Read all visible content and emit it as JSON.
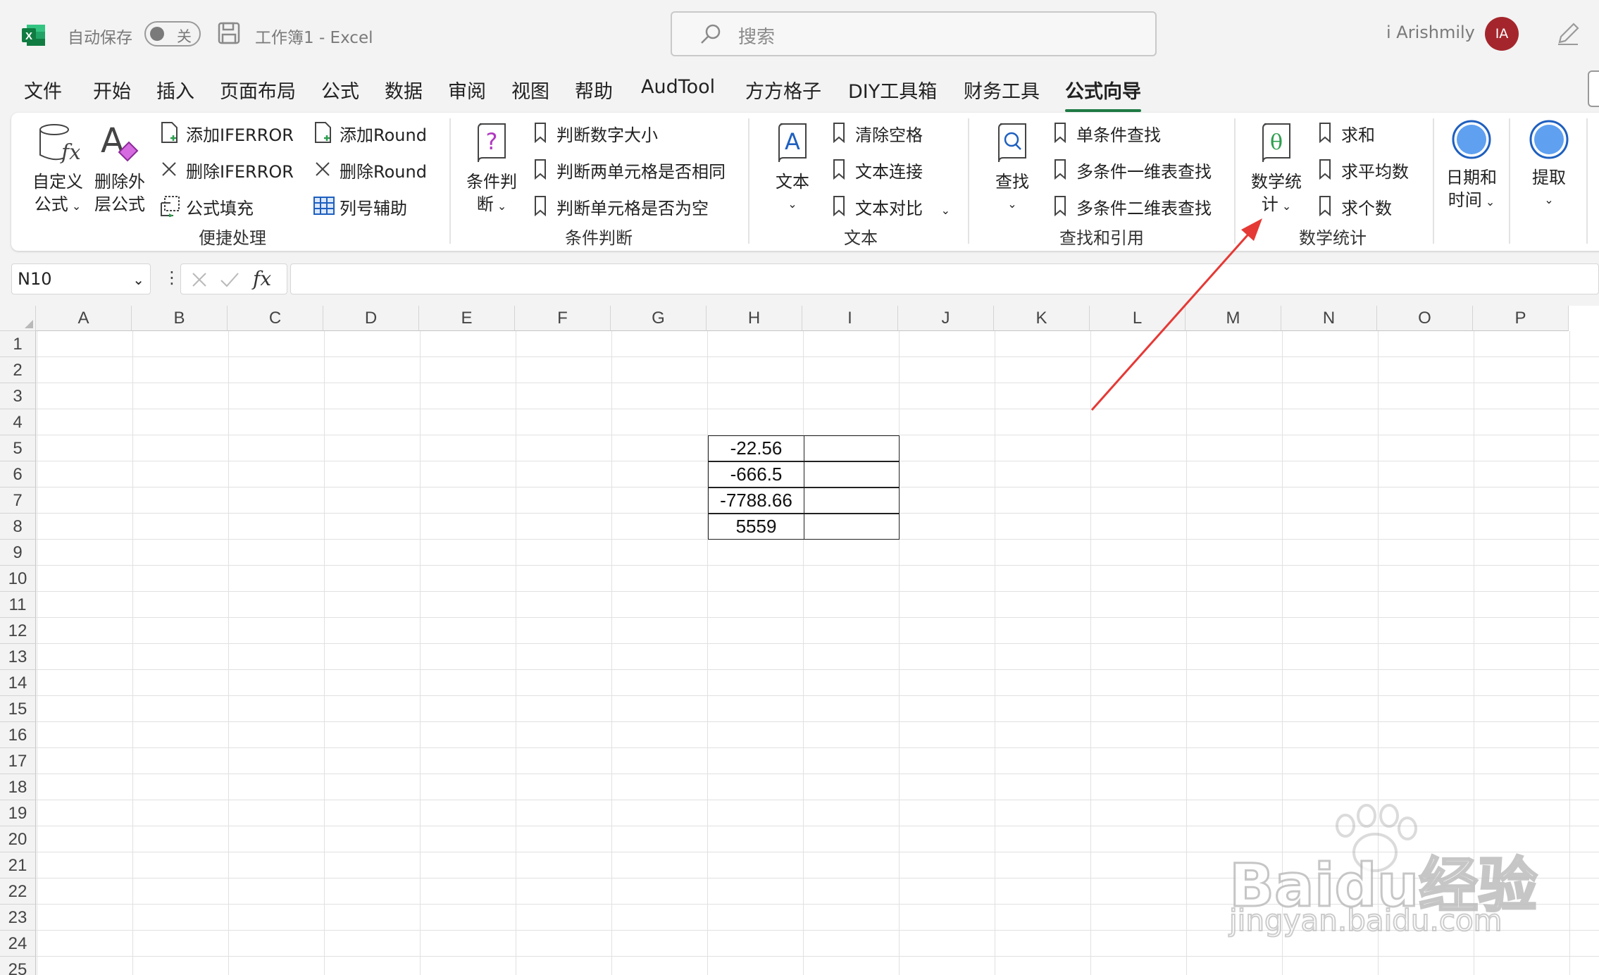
{
  "titlebar": {
    "autosave_label": "自动保存",
    "autosave_state": "关",
    "doc_title": "工作簿1  -  Excel",
    "search_placeholder": "搜索",
    "username": "i Arishmily",
    "avatar_initials": "IA"
  },
  "tabs": [
    {
      "label": "文件"
    },
    {
      "label": "开始"
    },
    {
      "label": "插入"
    },
    {
      "label": "页面布局"
    },
    {
      "label": "公式"
    },
    {
      "label": "数据"
    },
    {
      "label": "审阅"
    },
    {
      "label": "视图"
    },
    {
      "label": "帮助"
    },
    {
      "label": "AudTool"
    },
    {
      "label": "方方格子"
    },
    {
      "label": "DIY工具箱"
    },
    {
      "label": "财务工具"
    },
    {
      "label": "公式向导",
      "active": true
    }
  ],
  "ribbon": {
    "quick": {
      "group_label": "便捷处理",
      "custom_formula_line1": "自定义",
      "custom_formula_line2": "公式",
      "delete_outer_line1": "删除外",
      "delete_outer_line2": "层公式",
      "add_iferror": "添加IFERROR",
      "del_iferror": "删除IFERROR",
      "formula_fill": "公式填充",
      "add_round": "添加Round",
      "del_round": "删除Round",
      "col_helper": "列号辅助"
    },
    "condition": {
      "group_label": "条件判断",
      "big_line1": "条件判",
      "big_line2": "断",
      "item1": "判断数字大小",
      "item2": "判断两单元格是否相同",
      "item3": "判断单元格是否为空"
    },
    "text": {
      "group_label": "文本",
      "big_label": "文本",
      "item1": "清除空格",
      "item2": "文本连接",
      "item3": "文本对比"
    },
    "lookup": {
      "group_label": "查找和引用",
      "big_label": "查找",
      "item1": "单条件查找",
      "item2": "多条件一维表查找",
      "item3": "多条件二维表查找"
    },
    "math": {
      "group_label": "数学统计",
      "big_line1": "数学统",
      "big_line2": "计",
      "item1": "求和",
      "item2": "求平均数",
      "item3": "求个数"
    },
    "datetime": {
      "line1": "日期和",
      "line2": "时间"
    },
    "extract": {
      "label": "提取"
    }
  },
  "formula_bar": {
    "name_box": "N10",
    "fx": "fx",
    "formula": ""
  },
  "sheet": {
    "columns": [
      "A",
      "B",
      "C",
      "D",
      "E",
      "F",
      "G",
      "H",
      "I",
      "J",
      "K",
      "L",
      "M",
      "N",
      "O",
      "P"
    ],
    "rows": [
      "1",
      "2",
      "3",
      "4",
      "5",
      "6",
      "7",
      "8",
      "9",
      "10",
      "11",
      "12",
      "13",
      "14",
      "15",
      "16",
      "17",
      "18",
      "19",
      "20",
      "21",
      "22",
      "23",
      "24",
      "25"
    ],
    "values_H": [
      "-22.56",
      "-666.5",
      "-7788.66",
      "5559"
    ],
    "values_I": [
      "",
      "",
      "",
      ""
    ]
  },
  "watermark": {
    "brand": "Baidu经验",
    "url": "jingyan.baidu.com"
  },
  "colors": {
    "accent": "#1f7a45",
    "avatar": "#a4262c",
    "annotation_arrow": "#e53935",
    "ribbon_icon_blue": "#1e5fbf"
  }
}
